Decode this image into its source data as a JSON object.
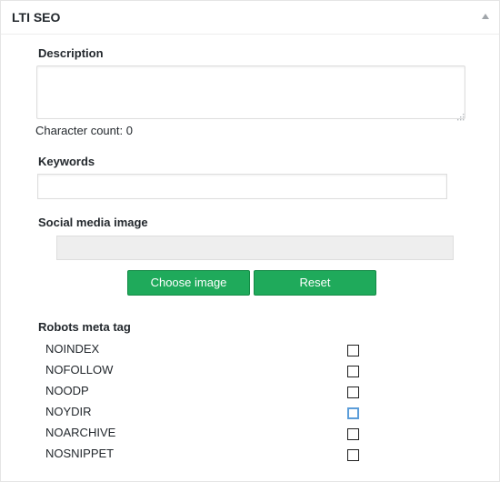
{
  "panel": {
    "title": "LTI SEO",
    "toggle_icon": "triangle-up-icon"
  },
  "description": {
    "label": "Description",
    "value": "",
    "char_count_label": "Character count: 0"
  },
  "keywords": {
    "label": "Keywords",
    "value": ""
  },
  "social_image": {
    "label": "Social media image",
    "value": "",
    "choose_label": "Choose image",
    "reset_label": "Reset"
  },
  "robots": {
    "label": "Robots meta tag",
    "options": [
      {
        "label": "NOINDEX",
        "checked": false
      },
      {
        "label": "NOFOLLOW",
        "checked": false
      },
      {
        "label": "NOODP",
        "checked": false
      },
      {
        "label": "NOYDIR",
        "checked": false
      },
      {
        "label": "NOARCHIVE",
        "checked": false
      },
      {
        "label": "NOSNIPPET",
        "checked": false
      }
    ]
  },
  "colors": {
    "button_green": "#1faa5b",
    "button_border": "#138a45"
  }
}
